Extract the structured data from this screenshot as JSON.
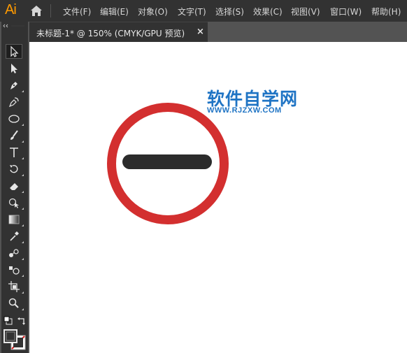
{
  "app": {
    "logo": "Ai"
  },
  "menu": [
    "文件(F)",
    "编辑(E)",
    "对象(O)",
    "文字(T)",
    "选择(S)",
    "效果(C)",
    "视图(V)",
    "窗口(W)",
    "帮助(H)"
  ],
  "document_tab": {
    "title": "未标题-1* @ 150% (CMYK/GPU 预览)",
    "close": "×"
  },
  "watermark": {
    "title": "软件自学网",
    "url": "WWW.RJZXW.COM"
  },
  "tools": [
    "selection-tool-icon",
    "direct-selection-tool-icon",
    "pen-tool-icon",
    "curvature-tool-icon",
    "ellipse-tool-icon",
    "paintbrush-tool-icon",
    "type-tool-icon",
    "rotate-tool-icon",
    "eraser-tool-icon",
    "shape-builder-tool-icon",
    "gradient-tool-icon",
    "eyedropper-tool-icon",
    "blend-tool-icon",
    "symbol-sprayer-tool-icon",
    "artboard-tool-icon",
    "zoom-tool-icon"
  ],
  "colors": {
    "sign_ring": "#d32f2f",
    "sign_bar": "#2b2b2b",
    "watermark": "#1f74c4",
    "logo": "#ff9a00"
  }
}
